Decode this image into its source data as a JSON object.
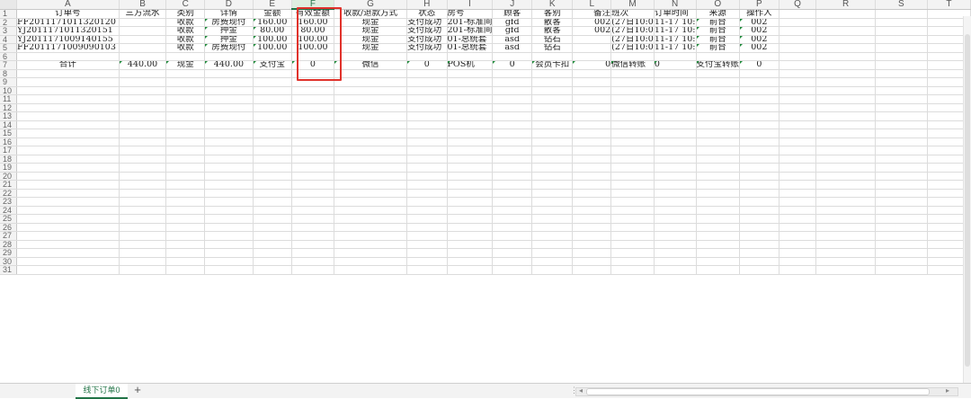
{
  "columns": [
    "A",
    "B",
    "C",
    "D",
    "E",
    "F",
    "G",
    "H",
    "I",
    "J",
    "K",
    "L",
    "M",
    "N",
    "O",
    "P",
    "Q",
    "R",
    "S",
    "T"
  ],
  "selected_column": "F",
  "header_row": [
    "订单号",
    "三方流水",
    "类别",
    "详情",
    "金额",
    "有效金额",
    "收款/退款方式",
    "状态",
    "房号",
    "顾客",
    "客别",
    "备注",
    "班次",
    "订单时间",
    "来源",
    "操作人",
    "",
    "",
    "",
    ""
  ],
  "data_rows": [
    [
      "FF2011171011320120",
      "",
      "收款",
      "房费现付",
      "160.00",
      "160.00",
      "现金",
      "支付成功",
      "201-标准间",
      "gfd",
      "散客",
      "002",
      "(27日10:0",
      "11-17 10:",
      "前台",
      "002",
      "",
      "",
      "",
      ""
    ],
    [
      "YJ2011171011320151",
      "",
      "收款",
      "押金",
      "80.00",
      "80.00",
      "现金",
      "支付成功",
      "201-标准间",
      "gfd",
      "散客",
      "002",
      "(27日10:0",
      "11-17 10:",
      "前台",
      "002",
      "",
      "",
      "",
      ""
    ],
    [
      "YJ2011171009140155",
      "",
      "收款",
      "押金",
      "100.00",
      "100.00",
      "现金",
      "支付成功",
      "01-总统套",
      "asd",
      "钻石",
      "",
      "(27日10:0",
      "11-17 10:",
      "前台",
      "002",
      "",
      "",
      "",
      ""
    ],
    [
      "FF2011171009090103",
      "",
      "收款",
      "房费现付",
      "100.00",
      "100.00",
      "现金",
      "支付成功",
      "01-总统套",
      "asd",
      "钻石",
      "",
      "(27日10:0",
      "11-17 10:",
      "前台",
      "002",
      "",
      "",
      "",
      ""
    ]
  ],
  "summary_row": [
    "合计",
    "440.00",
    "现金",
    "440.00",
    "支付宝",
    "0",
    "微信",
    "0",
    "POS机",
    "0",
    "会员卡扣",
    "0",
    "微信转账",
    "0",
    "支付宝转账",
    "0",
    "",
    "",
    "",
    ""
  ],
  "sheet_tab": "线下订单0",
  "add_tab_icon": "+"
}
